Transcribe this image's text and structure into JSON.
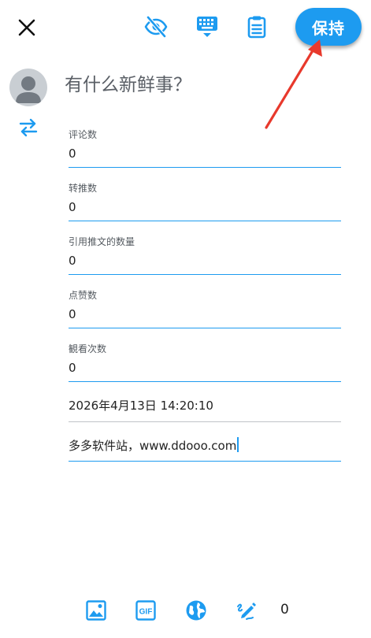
{
  "header": {
    "save_label": "保持"
  },
  "compose": {
    "placeholder": "有什么新鲜事？"
  },
  "fields": [
    {
      "label": "评论数",
      "value": "0"
    },
    {
      "label": "转推数",
      "value": "0"
    },
    {
      "label": "引用推文的数量",
      "value": "0"
    },
    {
      "label": "点赞数",
      "value": "0"
    },
    {
      "label": "観看次数",
      "value": "0"
    }
  ],
  "datetime": "2026年4月13日 14:20:10",
  "text_input": "多多软件站，www.ddooo.com",
  "bottom_bar": {
    "count": "0"
  },
  "icons": [
    "close-icon",
    "eye-off-icon",
    "keyboard-icon",
    "clipboard-icon",
    "switch-arrows-icon",
    "image-icon",
    "gif-icon",
    "globe-icon",
    "edit-icon"
  ],
  "colors": {
    "accent": "#1d9bf0",
    "annotation": "#e8392c",
    "text": "#222222",
    "muted": "#555b61",
    "divider": "#bfc3c7"
  }
}
